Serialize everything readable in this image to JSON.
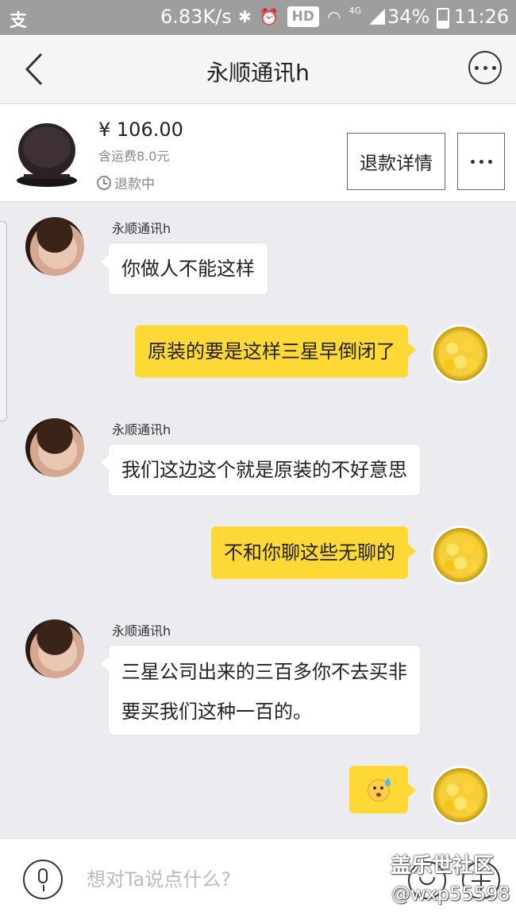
{
  "status_bar": {
    "app_glyph": "支",
    "network_speed": "6.83K/s",
    "hd": "HD",
    "net_type": "4G",
    "battery": "34%",
    "time": "11:26"
  },
  "header": {
    "title": "永顺通讯h"
  },
  "product": {
    "price": "¥ 106.00",
    "shipping": "含运费8.0元",
    "status": "退款中",
    "refund_button": "退款详情"
  },
  "messages": [
    {
      "side": "left",
      "sender": "永顺通讯h",
      "text": "你做人不能这样"
    },
    {
      "side": "right",
      "text": "原装的要是这样三星早倒闭了"
    },
    {
      "side": "left",
      "sender": "永顺通讯h",
      "text": "我们这边这个就是原装的不好意思"
    },
    {
      "side": "right",
      "text": "不和你聊这些无聊的"
    },
    {
      "side": "left",
      "sender": "永顺通讯h",
      "line1": "三星公司出来的三百多你不去买非",
      "line2": "要买我们这种一百的。"
    },
    {
      "side": "right",
      "emoji": "sweat-face-emoji"
    }
  ],
  "input": {
    "placeholder": "想对Ta说点什么?"
  },
  "watermark": {
    "line1": "盖乐世社区",
    "line2": "@wxp55598"
  }
}
